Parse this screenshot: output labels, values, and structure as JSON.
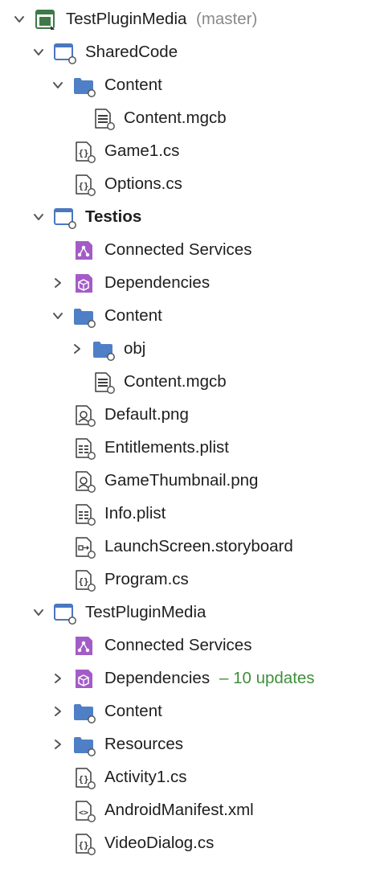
{
  "colors": {
    "folder": "#4f7fc6",
    "project": "#4a77c0",
    "solution": "#3d7a48",
    "services": "#a35cc7",
    "updates": "#3f8f3b",
    "branch": "#8a8a8a"
  },
  "tree": [
    {
      "label": "TestPluginMedia",
      "extra": "(master)",
      "extra_style": "gray",
      "icon": "solution-icon",
      "chevron": "down",
      "level": 0,
      "bold": false
    },
    {
      "label": "SharedCode",
      "icon": "project-icon",
      "chevron": "down",
      "level": 1,
      "bold": false
    },
    {
      "label": "Content",
      "icon": "folder-icon",
      "chevron": "down",
      "level": 2,
      "bold": false
    },
    {
      "label": "Content.mgcb",
      "icon": "mgcb-file-icon",
      "chevron": "none",
      "level": 3,
      "bold": false
    },
    {
      "label": "Game1.cs",
      "icon": "csharp-file-icon",
      "chevron": "none",
      "level": 2,
      "bold": false
    },
    {
      "label": "Options.cs",
      "icon": "csharp-file-icon",
      "chevron": "none",
      "level": 2,
      "bold": false
    },
    {
      "label": "Testios",
      "icon": "project-icon",
      "chevron": "down",
      "level": 1,
      "bold": true
    },
    {
      "label": "Connected Services",
      "icon": "connected-services-icon",
      "chevron": "none",
      "level": 2,
      "bold": false
    },
    {
      "label": "Dependencies",
      "icon": "dependencies-icon",
      "chevron": "right",
      "level": 2,
      "bold": false
    },
    {
      "label": "Content",
      "icon": "folder-icon",
      "chevron": "down",
      "level": 2,
      "bold": false
    },
    {
      "label": "obj",
      "icon": "folder-icon",
      "chevron": "right",
      "level": 3,
      "bold": false
    },
    {
      "label": "Content.mgcb",
      "icon": "mgcb-file-icon",
      "chevron": "none",
      "level": 3,
      "bold": false
    },
    {
      "label": "Default.png",
      "icon": "image-file-icon",
      "chevron": "none",
      "level": 2,
      "bold": false
    },
    {
      "label": "Entitlements.plist",
      "icon": "plist-file-icon",
      "chevron": "none",
      "level": 2,
      "bold": false
    },
    {
      "label": "GameThumbnail.png",
      "icon": "image-file-icon",
      "chevron": "none",
      "level": 2,
      "bold": false
    },
    {
      "label": "Info.plist",
      "icon": "plist-file-icon",
      "chevron": "none",
      "level": 2,
      "bold": false
    },
    {
      "label": "LaunchScreen.storyboard",
      "icon": "storyboard-file-icon",
      "chevron": "none",
      "level": 2,
      "bold": false
    },
    {
      "label": "Program.cs",
      "icon": "csharp-file-icon",
      "chevron": "none",
      "level": 2,
      "bold": false
    },
    {
      "label": "TestPluginMedia",
      "icon": "project-icon",
      "chevron": "down",
      "level": 1,
      "bold": false
    },
    {
      "label": "Connected Services",
      "icon": "connected-services-icon",
      "chevron": "none",
      "level": 2,
      "bold": false
    },
    {
      "label": "Dependencies",
      "extra": "– 10 updates",
      "extra_style": "green",
      "icon": "dependencies-icon",
      "chevron": "right",
      "level": 2,
      "bold": false
    },
    {
      "label": "Content",
      "icon": "folder-icon",
      "chevron": "right",
      "level": 2,
      "bold": false
    },
    {
      "label": "Resources",
      "icon": "folder-icon",
      "chevron": "right",
      "level": 2,
      "bold": false
    },
    {
      "label": "Activity1.cs",
      "icon": "csharp-file-icon",
      "chevron": "none",
      "level": 2,
      "bold": false
    },
    {
      "label": "AndroidManifest.xml",
      "icon": "xml-file-icon",
      "chevron": "none",
      "level": 2,
      "bold": false
    },
    {
      "label": "VideoDialog.cs",
      "icon": "csharp-file-icon",
      "chevron": "none",
      "level": 2,
      "bold": false
    }
  ]
}
